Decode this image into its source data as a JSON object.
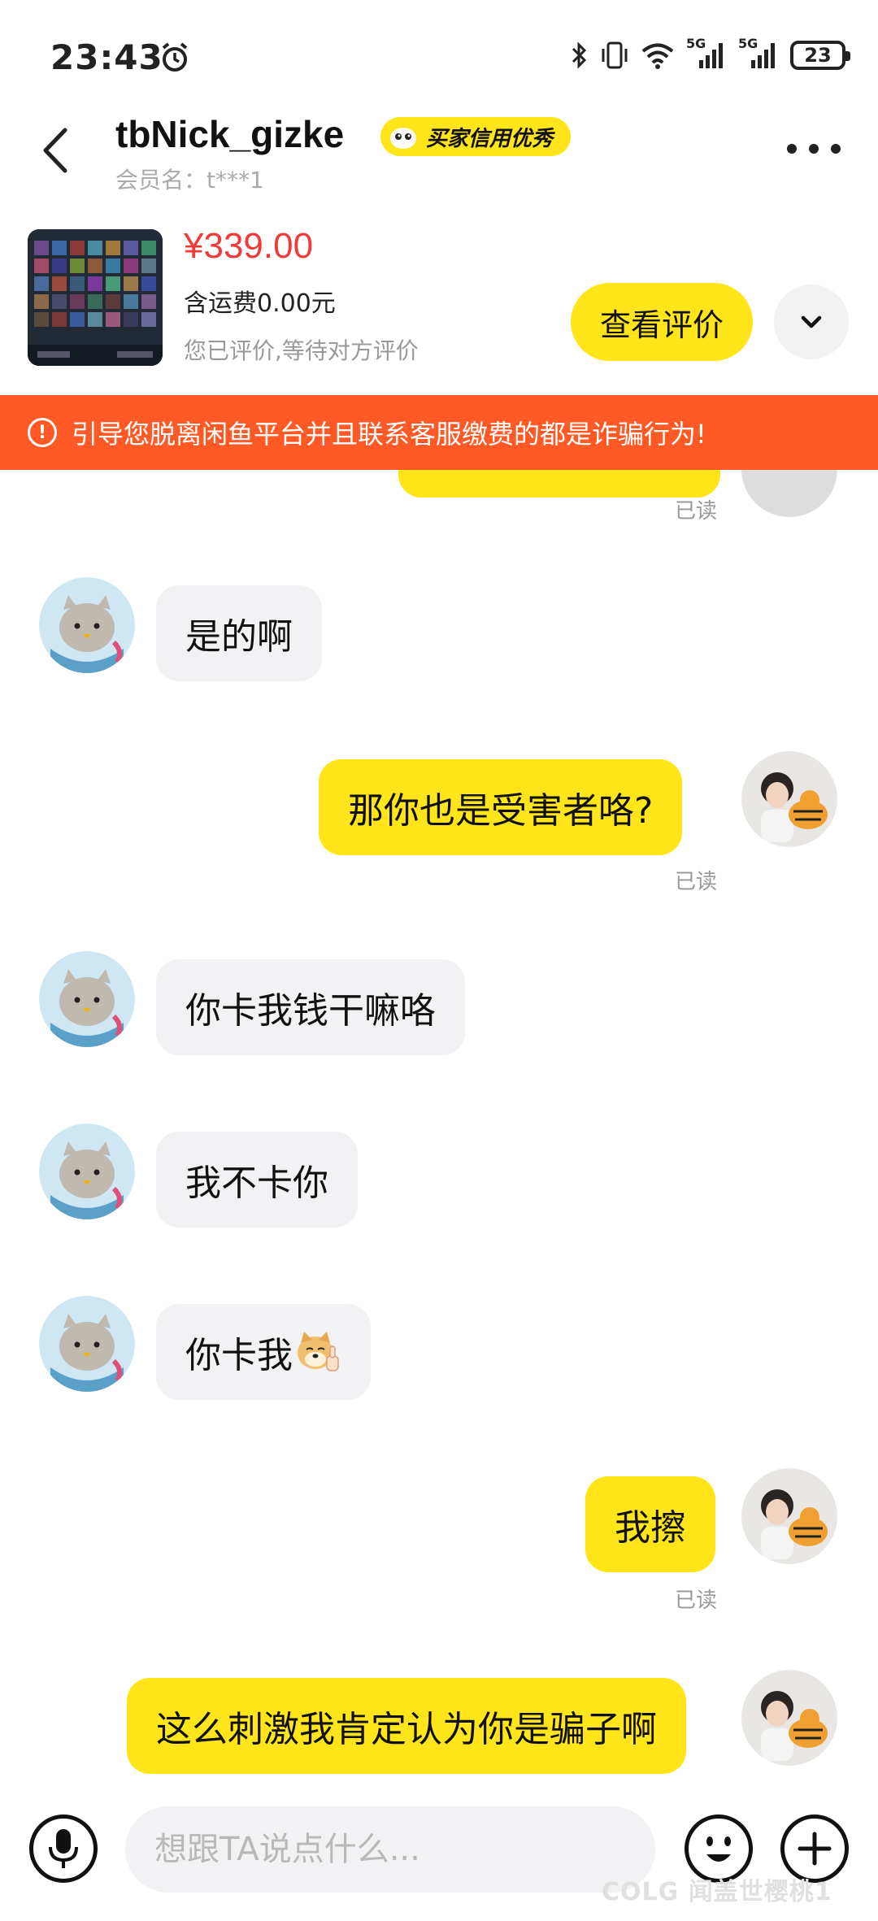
{
  "status_bar": {
    "time": "23:43",
    "network_1": "5G",
    "network_2": "5G",
    "battery": "23"
  },
  "header": {
    "nickname": "tbNick_gizke",
    "credit_badge": "买家信用优秀",
    "member_label": "会员名：t***1"
  },
  "product": {
    "price": "¥339.00",
    "shipping": "含运费0.00元",
    "rating_status": "您已评价,等待对方评价",
    "view_review_label": "查看评价"
  },
  "warning": {
    "text": "引导您脱离闲鱼平台并且联系客服缴费的都是诈骗行为!"
  },
  "messages": [
    {
      "from": "me",
      "text": "",
      "read": "已读"
    },
    {
      "from": "them",
      "text": "是的啊"
    },
    {
      "from": "me",
      "text": "那你也是受害者咯?",
      "read": "已读"
    },
    {
      "from": "them",
      "text": "你卡我钱干嘛咯"
    },
    {
      "from": "them",
      "text": "我不卡你"
    },
    {
      "from": "them",
      "text": "你卡我",
      "emoji": "doge-thumbs-up-emoji"
    },
    {
      "from": "me",
      "text": "我擦",
      "read": "已读"
    },
    {
      "from": "me",
      "text": "这么刺激我肯定认为你是骗子啊"
    }
  ],
  "input": {
    "placeholder": "想跟TA说点什么..."
  },
  "icons": {
    "back": "chevron-left-icon",
    "more": "more-dots-icon",
    "expand": "chevron-down-icon",
    "warning": "exclamation-circle-icon",
    "voice": "microphone-icon",
    "emoji": "smiley-icon",
    "plus": "plus-icon"
  },
  "colors": {
    "accent_yellow": "#ffe51a",
    "price_red": "#f03a3a",
    "warning_orange": "#ff5a26",
    "bubble_gray": "#f2f2f4"
  },
  "watermark": "COLG 闻盖世樱桃1"
}
